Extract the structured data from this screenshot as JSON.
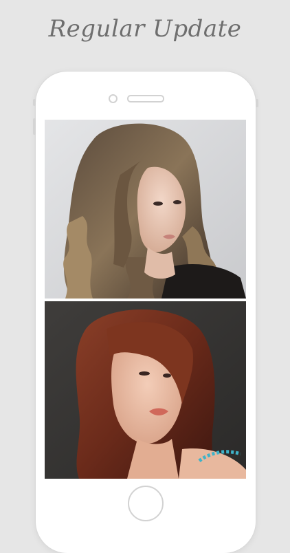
{
  "headline": "Regular Update",
  "colors": {
    "background": "#e6e6e6",
    "headline_text": "#6e6e6e",
    "phone_body": "#ffffff",
    "phone_outline": "#d2d2d2"
  },
  "screen": {
    "photos": [
      {
        "subject": "woman-curly-highlighted-half-updo",
        "background_color": "#d8d9db"
      },
      {
        "subject": "woman-auburn-layered-side-bangs",
        "background_color": "#3c3a38"
      }
    ]
  }
}
